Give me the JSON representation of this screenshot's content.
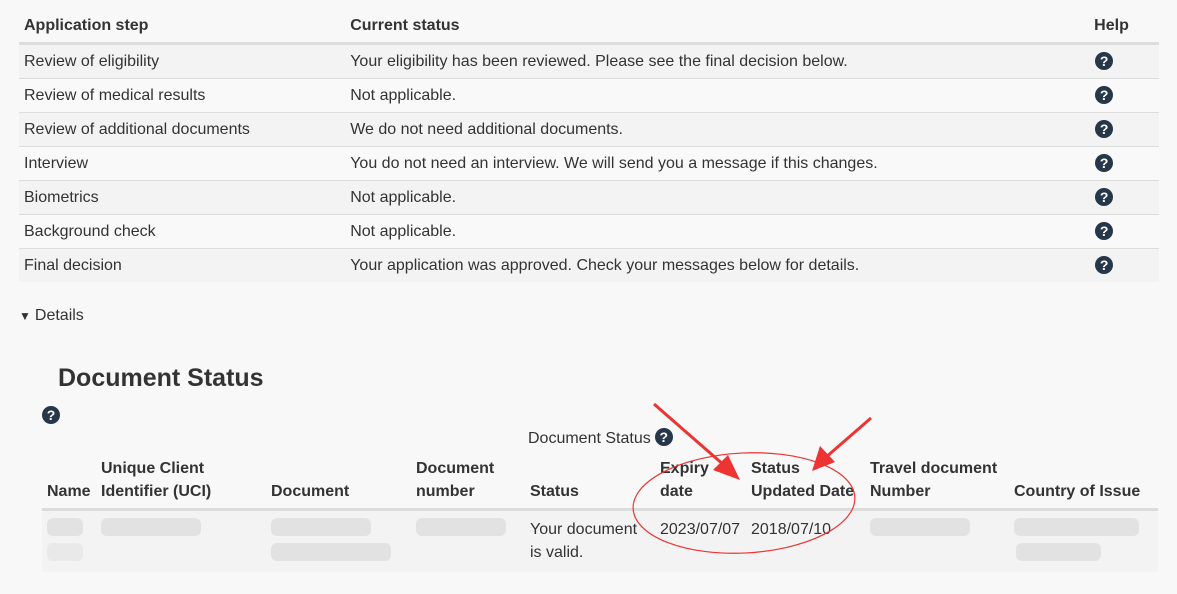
{
  "steps_table": {
    "headers": {
      "step": "Application step",
      "status": "Current status",
      "help": "Help"
    },
    "rows": [
      {
        "step": "Review of eligibility",
        "status": "Your eligibility has been reviewed. Please see the final decision below.",
        "help_icon": "?"
      },
      {
        "step": "Review of medical results",
        "status": "Not applicable.",
        "help_icon": "?"
      },
      {
        "step": "Review of additional documents",
        "status": "We do not need additional documents.",
        "help_icon": "?"
      },
      {
        "step": "Interview",
        "status": "You do not need an interview. We will send you a message if this changes.",
        "help_icon": "?"
      },
      {
        "step": "Biometrics",
        "status": "Not applicable.",
        "help_icon": "?"
      },
      {
        "step": "Background check",
        "status": "Not applicable.",
        "help_icon": "?"
      },
      {
        "step": "Final decision",
        "status": "Your application was approved. Check your messages below for details.",
        "help_icon": "?"
      }
    ]
  },
  "details": {
    "toggle_icon": "▼",
    "label": "Details"
  },
  "document_status": {
    "title": "Document Status",
    "help_icon": "?",
    "caption": "Document Status",
    "caption_help_icon": "?",
    "headers": {
      "name": "Name",
      "uci": "Unique Client Identifier (UCI)",
      "document": "Document",
      "document_number": "Document number",
      "status": "Status",
      "expiry_date": "Expiry date",
      "status_updated_date": "Status Updated Date",
      "travel_document_number": "Travel document Number",
      "country_of_issue": "Country of Issue"
    },
    "row": {
      "name": "[redacted]",
      "uci": "[redacted]",
      "document": "[redacted]",
      "document_number": "[redacted]",
      "status": "Your document is valid.",
      "expiry_date": "2023/07/07",
      "status_updated_date": "2018/07/10",
      "travel_document_number": "[redacted]",
      "country_of_issue": "[redacted]"
    }
  },
  "annotation": {
    "color": "#ee3333"
  }
}
